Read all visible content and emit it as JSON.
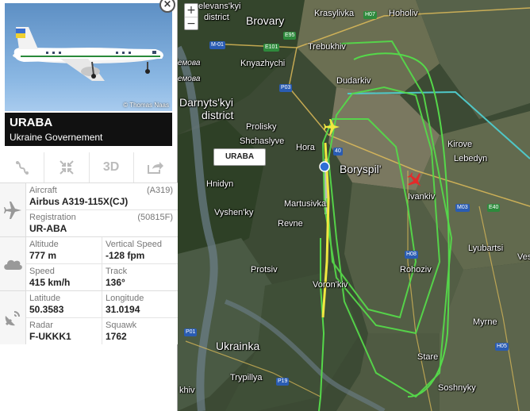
{
  "flight": {
    "callsign": "URABA",
    "operator": "Ukraine Governement",
    "photo_credit": "© Thomas Naas",
    "close_label": "×"
  },
  "actions": [
    {
      "name": "route-icon",
      "label": ""
    },
    {
      "name": "center-icon",
      "label": ""
    },
    {
      "name": "3d-view",
      "label": "3D"
    },
    {
      "name": "share-icon",
      "label": ""
    }
  ],
  "details": {
    "aircraft_label": "Aircraft",
    "aircraft_code": "(A319)",
    "aircraft_value": "Airbus A319-115X(CJ)",
    "registration_label": "Registration",
    "registration_code": "(50815F)",
    "registration_value": "UR-ABA",
    "altitude_label": "Altitude",
    "altitude_value": "777 m",
    "vspeed_label": "Vertical Speed",
    "vspeed_value": "-128 fpm",
    "speed_label": "Speed",
    "speed_value": "415 km/h",
    "track_label": "Track",
    "track_value": "136°",
    "lat_label": "Latitude",
    "lat_value": "50.3583",
    "lon_label": "Longitude",
    "lon_value": "31.0194",
    "radar_label": "Radar",
    "radar_value": "F-UKKK1",
    "squawk_label": "Squawk",
    "squawk_value": "1762"
  },
  "map": {
    "zoom_in": "+",
    "zoom_out": "−",
    "callout": "URABA",
    "places": {
      "obolon": "elevans'kyi",
      "obolon2": "district",
      "brovary": "Brovary",
      "krasylivka": "Krasylivka",
      "hoholiv": "Hoholiv",
      "trebukhiv": "Trebukhiv",
      "knyazhychi": "Knyazhychi",
      "dudarkiv": "Dudarkiv",
      "darnytskyi": "Darnyts'kyi",
      "district": "district",
      "prolisky": "Prolisky",
      "shchaslyve": "Shchaslyve",
      "hora": "Hora",
      "boryspil": "Boryspil'",
      "kirove": "Kirove",
      "lebedyn": "Lebedyn",
      "hnidyn": "Hnidyn",
      "martusivka": "Martusivka",
      "ivankiv": "Ivankiv",
      "vyshenky": "Vyshen'ky",
      "revne": "Revne",
      "lyubartsi": "Lyubartsi",
      "ves": "Ves",
      "protsiv": "Protsiv",
      "rohoziv": "Rohoziv",
      "voronkiv": "Voron'kiv",
      "myrne": "Myrne",
      "ukrainka": "Ukrainka",
      "stare": "Stare",
      "tryplyia": "Trypillya",
      "soshnyky": "Soshnyky",
      "nemo": "емова",
      "nemo2": "емова",
      "khiv": "khiv"
    },
    "roads": {
      "h07": "H07",
      "e95": "E95",
      "m01": "M-01",
      "e101": "E101",
      "p03": "P03",
      "m03": "M03",
      "e40": "E40",
      "h08": "H08",
      "p01": "P01",
      "p19": "P19",
      "h05": "H05",
      "r40": "40"
    },
    "colors": {
      "track": "#55d84a",
      "approach": "#f0e840",
      "radar_line": "#4fc7c7"
    }
  }
}
